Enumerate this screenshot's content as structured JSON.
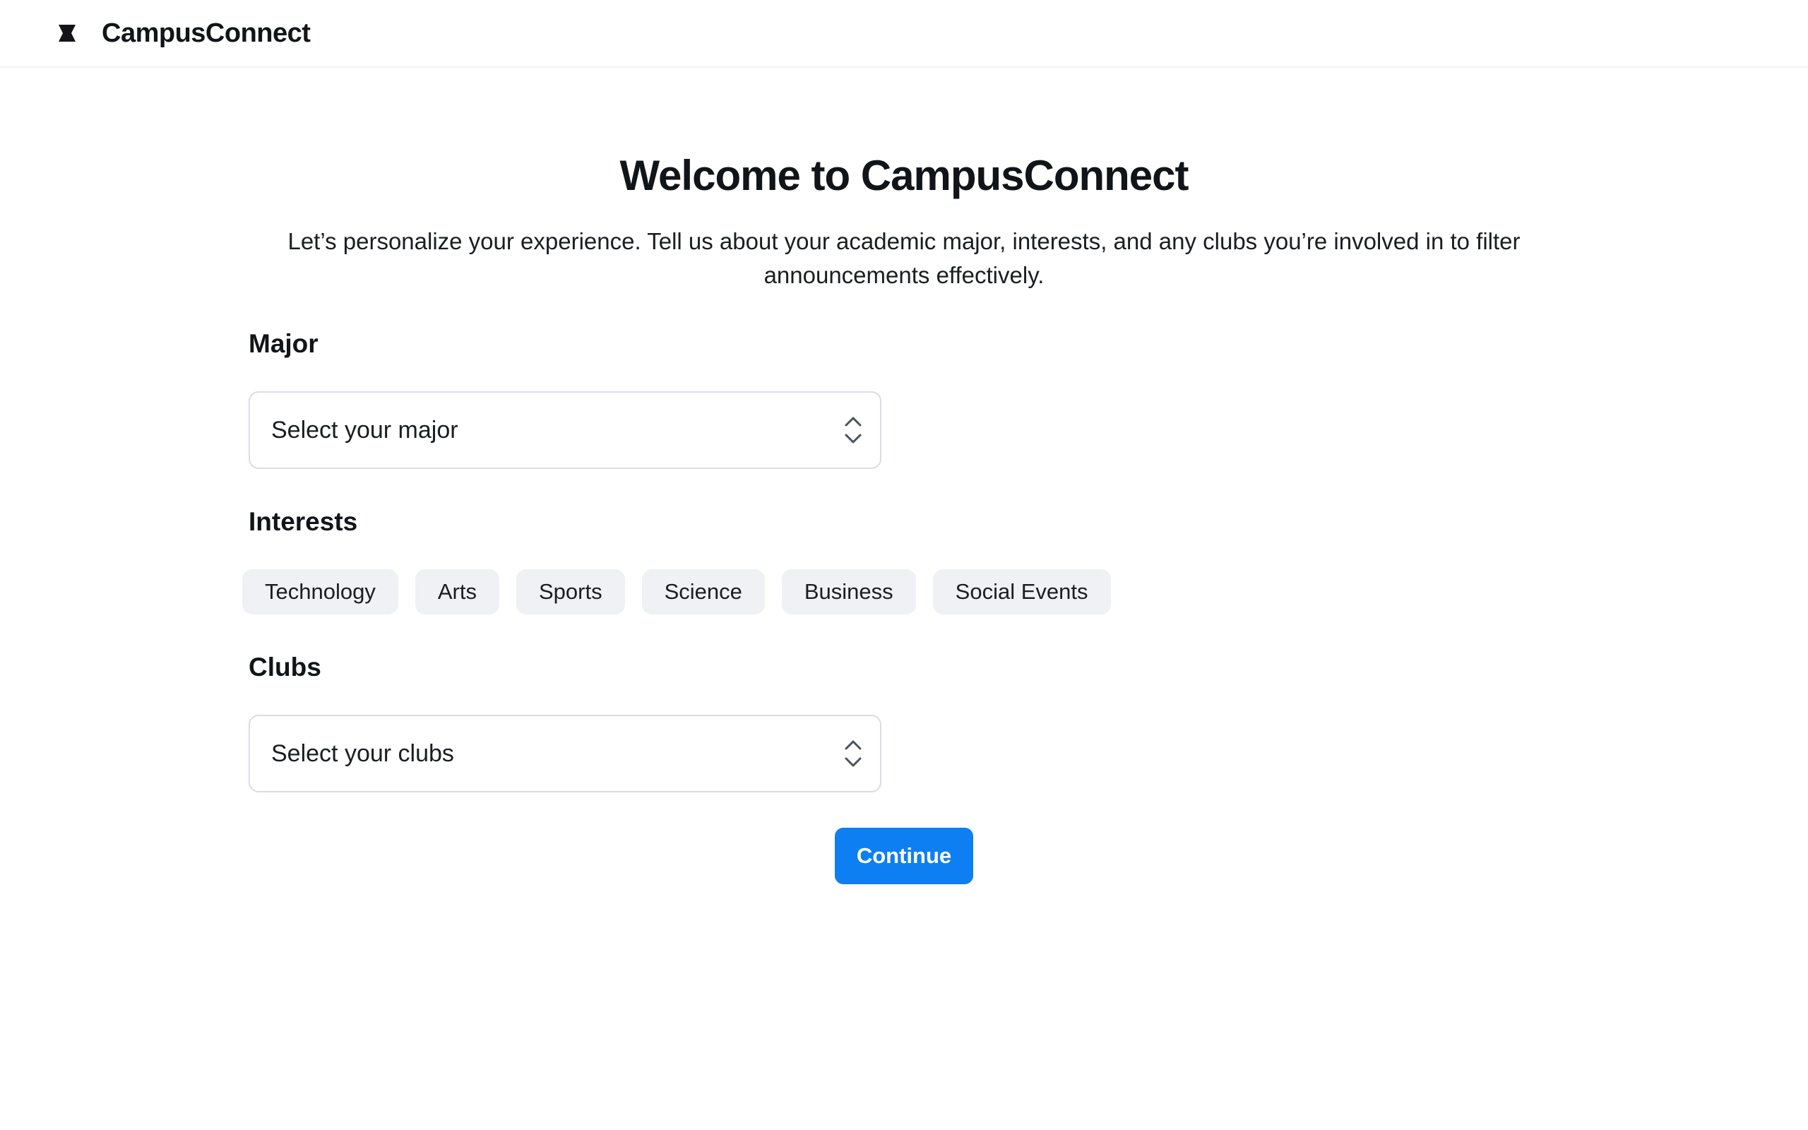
{
  "header": {
    "logo_icon": "campus-logo-icon",
    "app_title": "CampusConnect"
  },
  "welcome": {
    "title": "Welcome to CampusConnect",
    "description": "Let’s personalize your experience. Tell us about your academic major, interests, and any clubs you’re involved in to filter announcements effectively."
  },
  "major": {
    "label": "Major",
    "placeholder": "Select your major",
    "icon": "chevron-up-down-icon"
  },
  "interests": {
    "label": "Interests",
    "chips": [
      "Technology",
      "Arts",
      "Sports",
      "Science",
      "Business",
      "Social Events"
    ]
  },
  "clubs": {
    "label": "Clubs",
    "placeholder": "Select your clubs",
    "icon": "chevron-up-down-icon"
  },
  "actions": {
    "continue_label": "Continue"
  },
  "colors": {
    "accent": "#0d7ff2",
    "chip_bg": "#eff1f4",
    "border": "#d9dde3",
    "text": "#111418"
  }
}
